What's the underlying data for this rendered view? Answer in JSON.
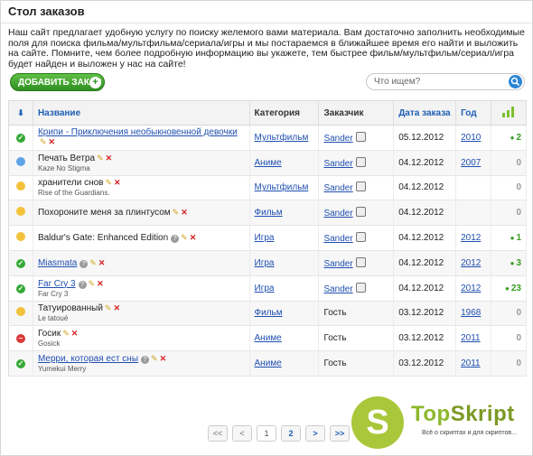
{
  "page": {
    "title": "Стол заказов",
    "intro": "Наш сайт предлагает удобную услугу по поиску желемого вами материала. Вам достаточно заполнить необходимые поля для поиска фильма/мультфильма/сериала/игры и мы постараемся в ближайшее время его найти и выложить на сайте. Помните, чем более подробную информацию вы укажете, тем быстрее фильм/мультфильм/сериал/игра будет найден и выложен у нас на сайте!"
  },
  "toolbar": {
    "add_label": "ДОБАВИТЬ ЗАКАЗ",
    "add_icon": "plus-icon",
    "search_placeholder": "Что ищем?",
    "search_icon": "search-icon"
  },
  "table": {
    "headers": {
      "name": "Название",
      "category": "Категория",
      "customer": "Заказчик",
      "date": "Дата заказа",
      "year": "Год"
    },
    "rows": [
      {
        "status": "done",
        "title": "Крипи - Приключения необыкновенной девочки",
        "subtitle": "",
        "title_link": true,
        "help": false,
        "category": "Мультфильм",
        "customer": "Sander",
        "customer_link": true,
        "date": "05.12.2012",
        "year": "2010",
        "count": "2",
        "count_positive": true
      },
      {
        "status": "progress",
        "title": "Печать Ветра",
        "subtitle": "Kaze No Stigma",
        "title_link": false,
        "help": false,
        "category": "Аниме",
        "customer": "Sander",
        "customer_link": true,
        "date": "04.12.2012",
        "year": "2007",
        "count": "0",
        "count_positive": false
      },
      {
        "status": "pending",
        "title": "хранители снов",
        "subtitle": "Rise of the Guardians.",
        "title_link": false,
        "help": false,
        "category": "Мультфильм",
        "customer": "Sander",
        "customer_link": true,
        "date": "04.12.2012",
        "year": "",
        "count": "0",
        "count_positive": false
      },
      {
        "status": "pending",
        "title": "Похороните меня за плинтусом",
        "subtitle": "",
        "title_link": false,
        "help": false,
        "category": "Фильм",
        "customer": "Sander",
        "customer_link": true,
        "date": "04.12.2012",
        "year": "",
        "count": "0",
        "count_positive": false
      },
      {
        "status": "pending",
        "title": "Baldur's Gate: Enhanced Edition",
        "subtitle": "",
        "title_link": false,
        "help": true,
        "category": "Игра",
        "customer": "Sander",
        "customer_link": true,
        "date": "04.12.2012",
        "year": "2012",
        "count": "1",
        "count_positive": true
      },
      {
        "status": "done",
        "title": "Miasmata",
        "subtitle": "",
        "title_link": true,
        "help": true,
        "category": "Игра",
        "customer": "Sander",
        "customer_link": true,
        "date": "04.12.2012",
        "year": "2012",
        "count": "3",
        "count_positive": true
      },
      {
        "status": "done",
        "title": "Far Cry 3",
        "subtitle": "Far Cry 3",
        "title_link": true,
        "help": true,
        "category": "Игра",
        "customer": "Sander",
        "customer_link": true,
        "date": "04.12.2012",
        "year": "2012",
        "count": "23",
        "count_positive": true
      },
      {
        "status": "pending",
        "title": "Татуированный",
        "subtitle": "Le tatoué",
        "title_link": false,
        "help": false,
        "category": "Фильм",
        "customer": "Гость",
        "customer_link": false,
        "date": "03.12.2012",
        "year": "1968",
        "count": "0",
        "count_positive": false
      },
      {
        "status": "rejected",
        "title": "Госик",
        "subtitle": "Gosick",
        "title_link": false,
        "help": false,
        "category": "Аниме",
        "customer": "Гость",
        "customer_link": false,
        "date": "03.12.2012",
        "year": "2011",
        "count": "0",
        "count_positive": false
      },
      {
        "status": "done",
        "title": "Мерри, которая ест сны",
        "subtitle": "Yumekui Merry",
        "title_link": true,
        "help": true,
        "category": "Аниме",
        "customer": "Гость",
        "customer_link": false,
        "date": "03.12.2012",
        "year": "2011",
        "count": "0",
        "count_positive": false
      }
    ]
  },
  "pagination": [
    "<<",
    "<",
    "1",
    "2",
    ">",
    ">>"
  ],
  "pagination_current": "2",
  "watermark": {
    "letter": "S",
    "brand_a": "Top",
    "brand_b": "Skript",
    "tagline": "Всё о скриптах и для скриптов..."
  },
  "colors": {
    "accent_green": "#34a936",
    "link_blue": "#1f4fb0",
    "button_green": "#2f8f22"
  }
}
